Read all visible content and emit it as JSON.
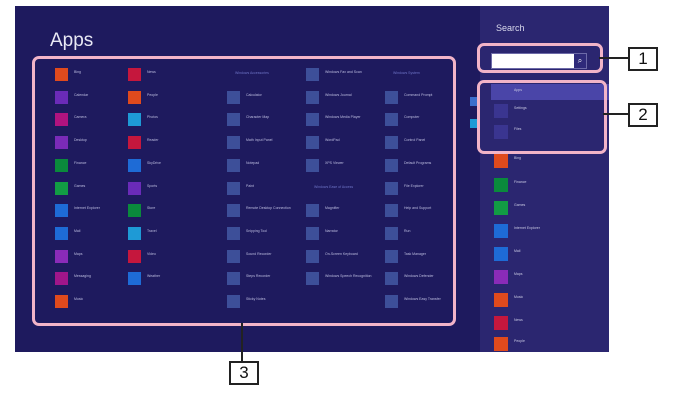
{
  "screen": {
    "title": "Apps",
    "search_pane": {
      "title": "Search",
      "search_value": "",
      "search_button_icon": "search-icon",
      "items": [
        {
          "label": "Apps",
          "icon": "apps-icon",
          "color": "#4a45a8",
          "selected": true
        },
        {
          "label": "Settings",
          "icon": "gear-icon",
          "color": "#3a3590"
        },
        {
          "label": "Files",
          "icon": "file-icon",
          "color": "#3a3590"
        },
        {
          "label": "Bing",
          "icon": "bing-icon",
          "color": "#e04a1d"
        },
        {
          "label": "Finance",
          "icon": "finance-icon",
          "color": "#0a8a3c"
        },
        {
          "label": "Games",
          "icon": "games-icon",
          "color": "#129c44"
        },
        {
          "label": "Internet Explorer",
          "icon": "ie-icon",
          "color": "#1e6bd6"
        },
        {
          "label": "Mail",
          "icon": "mail-icon",
          "color": "#1e6bd6"
        },
        {
          "label": "Maps",
          "icon": "maps-icon",
          "color": "#8a2bb8"
        },
        {
          "label": "Music",
          "icon": "music-icon",
          "color": "#e04a1d"
        },
        {
          "label": "News",
          "icon": "news-icon",
          "color": "#c5173d"
        },
        {
          "label": "People",
          "icon": "people-icon",
          "color": "#e04a1d"
        }
      ]
    },
    "groups": [
      {
        "header": "",
        "items": [
          {
            "label": "Bing",
            "color": "#e04a1d"
          },
          {
            "label": "Calendar",
            "color": "#6a2bb8"
          },
          {
            "label": "Camera",
            "color": "#b0137f"
          },
          {
            "label": "Desktop",
            "color": "#7a2bb8"
          },
          {
            "label": "Finance",
            "color": "#0a8a3c"
          },
          {
            "label": "Games",
            "color": "#129c44"
          },
          {
            "label": "Internet Explorer",
            "color": "#1e6bd6"
          },
          {
            "label": "Mail",
            "color": "#1e6bd6"
          },
          {
            "label": "Maps",
            "color": "#8a2bb8"
          },
          {
            "label": "Messaging",
            "color": "#a0168a"
          },
          {
            "label": "Music",
            "color": "#e04a1d"
          }
        ]
      },
      {
        "header": "",
        "items": [
          {
            "label": "News",
            "color": "#c5173d"
          },
          {
            "label": "People",
            "color": "#e04a1d"
          },
          {
            "label": "Photos",
            "color": "#1e9ad6"
          },
          {
            "label": "Reader",
            "color": "#c5173d"
          },
          {
            "label": "SkyDrive",
            "color": "#1e6bd6"
          },
          {
            "label": "Sports",
            "color": "#6a2bb8"
          },
          {
            "label": "Store",
            "color": "#0a8a3c"
          },
          {
            "label": "Travel",
            "color": "#1e9ad6"
          },
          {
            "label": "Video",
            "color": "#c5173d"
          },
          {
            "label": "Weather",
            "color": "#1e6bd6"
          }
        ]
      },
      {
        "header": "Windows Accessories",
        "items": [
          {
            "label": "Calculator",
            "color": "#3d4f99"
          },
          {
            "label": "Character Map",
            "color": "#3d4f99"
          },
          {
            "label": "Math Input Panel",
            "color": "#3d4f99"
          },
          {
            "label": "Notepad",
            "color": "#3d4f99"
          },
          {
            "label": "Paint",
            "color": "#3d4f99"
          },
          {
            "label": "Remote Desktop Connection",
            "color": "#3d4f99"
          },
          {
            "label": "Snipping Tool",
            "color": "#3d4f99"
          },
          {
            "label": "Sound Recorder",
            "color": "#3d4f99"
          },
          {
            "label": "Steps Recorder",
            "color": "#3d4f99"
          },
          {
            "label": "Sticky Notes",
            "color": "#3d4f99"
          }
        ]
      },
      {
        "header": "Windows Ease of Access",
        "items": [
          {
            "label": "Windows Fax and Scan",
            "color": "#3d4f99"
          },
          {
            "label": "Windows Journal",
            "color": "#3d4f99"
          },
          {
            "label": "Windows Media Player",
            "color": "#3d4f99"
          },
          {
            "label": "WordPad",
            "color": "#3d4f99"
          },
          {
            "label": "XPS Viewer",
            "color": "#3d4f99"
          },
          {
            "label": "Magnifier",
            "color": "#3d4f99"
          },
          {
            "label": "Narrator",
            "color": "#3d4f99"
          },
          {
            "label": "On-Screen Keyboard",
            "color": "#3d4f99"
          },
          {
            "label": "Windows Speech Recognition",
            "color": "#3d4f99"
          }
        ]
      },
      {
        "header": "Windows System",
        "items": [
          {
            "label": "Command Prompt",
            "color": "#3d4f99"
          },
          {
            "label": "Computer",
            "color": "#3d4f99"
          },
          {
            "label": "Control Panel",
            "color": "#3d4f99"
          },
          {
            "label": "Default Programs",
            "color": "#3d4f99"
          },
          {
            "label": "File Explorer",
            "color": "#3d4f99"
          },
          {
            "label": "Help and Support",
            "color": "#3d4f99"
          },
          {
            "label": "Run",
            "color": "#3d4f99"
          },
          {
            "label": "Task Manager",
            "color": "#3d4f99"
          },
          {
            "label": "Windows Defender",
            "color": "#3d4f99"
          },
          {
            "label": "Windows Easy Transfer",
            "color": "#3d4f99"
          }
        ]
      }
    ]
  },
  "callouts": [
    {
      "number": "1",
      "target": "search box"
    },
    {
      "number": "2",
      "target": "search categories"
    },
    {
      "number": "3",
      "target": "apps list"
    }
  ],
  "colors": {
    "screen_bg": "#1e1a5e",
    "pane_bg": "#2b2670",
    "callout_outline": "#f2b4c8"
  }
}
